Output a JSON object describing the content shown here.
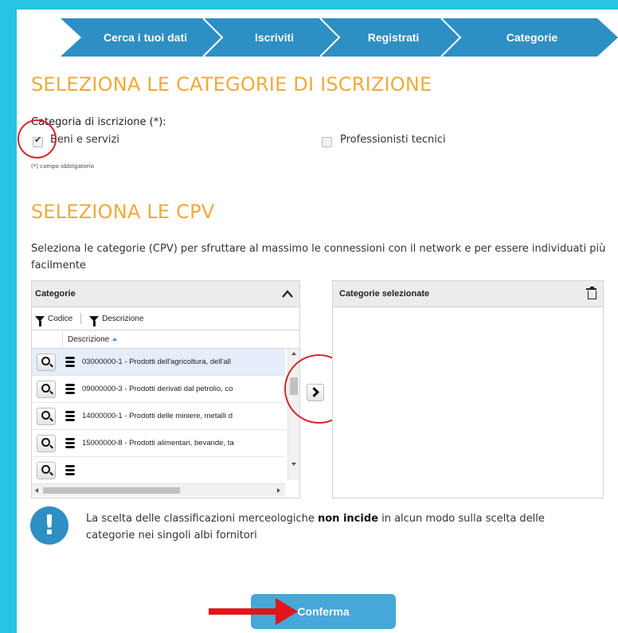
{
  "wizard": {
    "steps": [
      "Cerca i tuoi dati",
      "Iscriviti",
      "Registrati",
      "Categorie"
    ],
    "color": "#2d8fc3"
  },
  "section1": {
    "title": "SELEZIONA LE CATEGORIE DI ISCRIZIONE",
    "field_label": "Categoria di iscrizione (*):",
    "options": [
      {
        "label": "Beni e servizi",
        "checked": true
      },
      {
        "label": "Professionisti tecnici",
        "checked": false
      }
    ],
    "required_note": "(*) campo obbligatorio"
  },
  "section2": {
    "title": "SELEZIONA LE CPV",
    "intro": "Seleziona le categorie (CPV) per sfruttare al massimo le connessioni con il network e per essere individuati più facilmente"
  },
  "left_panel": {
    "title": "Categorie",
    "filters": [
      "Codice",
      "Descrizione"
    ],
    "column": "Descrizione",
    "rows": [
      "03000000-1 - Prodotti dell'agricoltura, dell'all",
      "09000000-3 - Prodotti derivati dal petrolio, co",
      "14000000-1 - Prodotti delle miniere, metalli d",
      "15000000-8 - Prodotti alimentari, bevande, ta",
      ""
    ]
  },
  "right_panel": {
    "title": "Categorie selezionate"
  },
  "info": {
    "icon": "!",
    "text_before": "La scelta delle classificazioni merceologiche ",
    "text_bold": "non incide",
    "text_after": " in alcun modo sulla scelta delle categorie nei singoli albi fornitori"
  },
  "confirm_label": "Conferma",
  "colors": {
    "accent_orange": "#f2a93a",
    "annotation_red": "#d9252a",
    "frame_cyan": "#29c3e4"
  }
}
